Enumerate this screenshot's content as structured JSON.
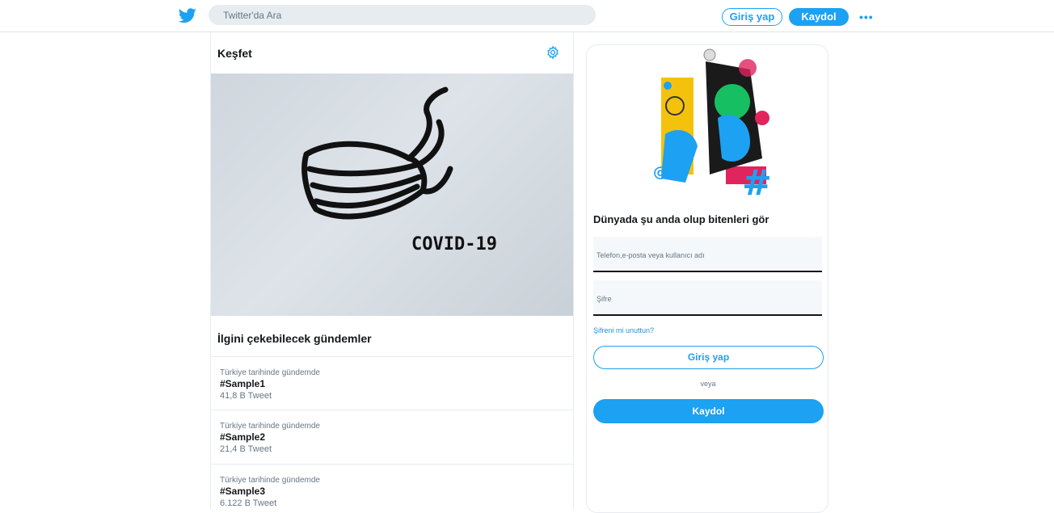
{
  "header": {
    "search_placeholder": "Twitter'da Ara",
    "login_label": "Giriş yap",
    "signup_label": "Kaydol",
    "more_label": "•••",
    "brand_color": "#1da1f2"
  },
  "explore": {
    "title": "Keşfet",
    "hero_text": "COVID-19",
    "trends_title": "İlgini çekebilecek gündemler",
    "trends": [
      {
        "context": "Türkiye tarihinde gündemde",
        "tag": "#Sample1",
        "count": "41,8 B Tweet"
      },
      {
        "context": "Türkiye tarihinde gündemde",
        "tag": "#Sample2",
        "count": "21,4 B Tweet"
      },
      {
        "context": "Türkiye tarihinde gündemde",
        "tag": "#Sample3",
        "count": "6.122 B Tweet"
      }
    ]
  },
  "signup_panel": {
    "title": "Dünyada şu anda olup bitenleri gör",
    "username_label": "Telefon,e-posta veya kullanıcı adı",
    "password_label": "Şifre",
    "forgot_label": "Şifreni mi unuttun?",
    "login_label": "Giriş yap",
    "or_label": "veya",
    "signup_label": "Kaydol"
  }
}
